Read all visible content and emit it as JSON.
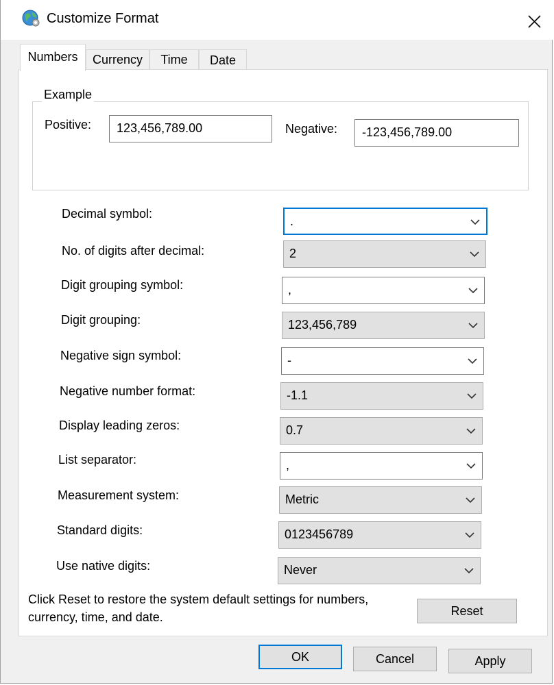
{
  "window": {
    "title": "Customize Format"
  },
  "icons": {
    "app": "globe-settings-icon",
    "close": "close-icon",
    "dropdown": "chevron-down-icon"
  },
  "tabs": [
    {
      "label": "Numbers",
      "active": true
    },
    {
      "label": "Currency",
      "active": false
    },
    {
      "label": "Time",
      "active": false
    },
    {
      "label": "Date",
      "active": false
    }
  ],
  "example": {
    "legend": "Example",
    "positive_label": "Positive:",
    "positive_value": "123,456,789.00",
    "negative_label": "Negative:",
    "negative_value": "-123,456,789.00"
  },
  "settings": [
    {
      "label": "Decimal symbol:",
      "value": ".",
      "editable": true,
      "focused": true
    },
    {
      "label": "No. of digits after decimal:",
      "value": "2",
      "editable": false
    },
    {
      "label": "Digit grouping symbol:",
      "value": ",",
      "editable": true
    },
    {
      "label": "Digit grouping:",
      "value": "123,456,789",
      "editable": false
    },
    {
      "label": "Negative sign symbol:",
      "value": "-",
      "editable": true
    },
    {
      "label": "Negative number format:",
      "value": "-1.1",
      "editable": false
    },
    {
      "label": "Display leading zeros:",
      "value": "0.7",
      "editable": false
    },
    {
      "label": "List separator:",
      "value": ",",
      "editable": true
    },
    {
      "label": "Measurement system:",
      "value": "Metric",
      "editable": false
    },
    {
      "label": "Standard digits:",
      "value": "0123456789",
      "editable": false
    },
    {
      "label": "Use native digits:",
      "value": "Never",
      "editable": false
    }
  ],
  "reset_info": "Click Reset to restore the system default settings for numbers, currency, time, and date.",
  "buttons": {
    "reset": "Reset",
    "ok": "OK",
    "cancel": "Cancel",
    "apply": "Apply"
  },
  "colors": {
    "focus_accent": "#0078d7",
    "button_face": "#e1e1e1",
    "dialog_bg": "#f0f0f0"
  }
}
